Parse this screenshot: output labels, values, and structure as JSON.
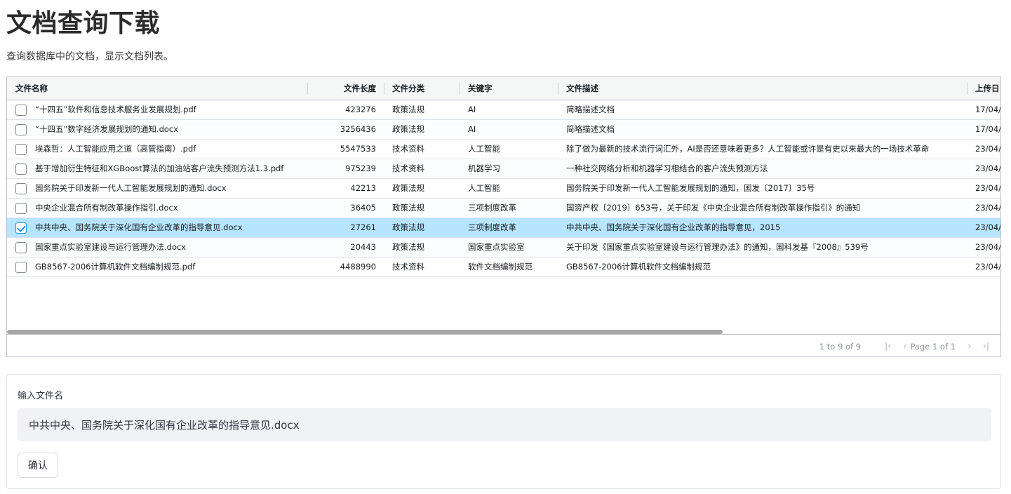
{
  "page": {
    "title": "文档查询下载",
    "subtitle": "查询数据库中的文档，显示文档列表。"
  },
  "grid": {
    "columns": [
      "文件名称",
      "文件长度",
      "文件分类",
      "关键字",
      "文件描述",
      "上传日"
    ],
    "rows": [
      {
        "checked": false,
        "name": "“十四五”软件和信息技术服务业发展规划.pdf",
        "size": "423276",
        "category": "政策法规",
        "keyword": "AI",
        "desc": "简略描述文档",
        "date": "17/04/"
      },
      {
        "checked": false,
        "name": "“十四五”数字经济发展规划的通知.docx",
        "size": "3256436",
        "category": "政策法规",
        "keyword": "AI",
        "desc": "简略描述文档",
        "date": "17/04/"
      },
      {
        "checked": false,
        "name": "埃森哲：人工智能应用之道（高管指南）.pdf",
        "size": "5547533",
        "category": "技术资料",
        "keyword": "人工智能",
        "desc": "除了做为最新的技术流行词汇外，AI是否还意味着更多？人工智能或许是有史以来最大的一场技术革命",
        "date": "23/04/"
      },
      {
        "checked": false,
        "name": "基于增加衍生特征和XGBoost算法的加油站客户流失预测方法1.3.pdf",
        "size": "975239",
        "category": "技术资料",
        "keyword": "机器学习",
        "desc": "一种社交网络分析和机器学习相结合的客户流失预测方法",
        "date": "23/04/"
      },
      {
        "checked": false,
        "name": "国务院关于印发新一代人工智能发展规划的通知.docx",
        "size": "42213",
        "category": "政策法规",
        "keyword": "人工智能",
        "desc": "国务院关于印发新一代人工智能发展规划的通知，国发〔2017〕35号",
        "date": "23/04/"
      },
      {
        "checked": false,
        "name": "中央企业混合所有制改革操作指引.docx",
        "size": "36405",
        "category": "政策法规",
        "keyword": "三项制度改革",
        "desc": "国资产权〔2019〕653号，关于印发《中央企业混合所有制改革操作指引》的通知",
        "date": "23/04/"
      },
      {
        "checked": true,
        "name": "中共中央、国务院关于深化国有企业改革的指导意见.docx",
        "size": "27261",
        "category": "政策法规",
        "keyword": "三项制度改革",
        "desc": "中共中央、国务院关于深化国有企业改革的指导意见，2015",
        "date": "23/04/"
      },
      {
        "checked": false,
        "name": "国家重点实验室建设与运行管理办法.docx",
        "size": "20443",
        "category": "政策法规",
        "keyword": "国家重点实验室",
        "desc": "关于印发《国家重点实验室建设与运行管理办法》的通知，国科发基『2008』539号",
        "date": "23/04/"
      },
      {
        "checked": false,
        "name": "GB8567-2006计算机软件文档编制规范.pdf",
        "size": "4488990",
        "category": "技术资料",
        "keyword": "软件文档编制规范",
        "desc": "GB8567-2006计算机软件文档编制规范",
        "date": "23/04/"
      }
    ],
    "pager": {
      "summary": "1 to 9 of 9",
      "page_text": "Page 1 of 1",
      "icons": [
        "first-page-icon",
        "prev-page-icon",
        "next-page-icon",
        "last-page-icon"
      ]
    }
  },
  "form": {
    "label": "输入文件名",
    "value": "中共中央、国务院关于深化国有企业改革的指导意见.docx",
    "button": "确认"
  },
  "colors": {
    "selected_row": "#b7e4ff",
    "checkbox_accent": "#2196f3",
    "input_bg": "#f0f2f6"
  }
}
